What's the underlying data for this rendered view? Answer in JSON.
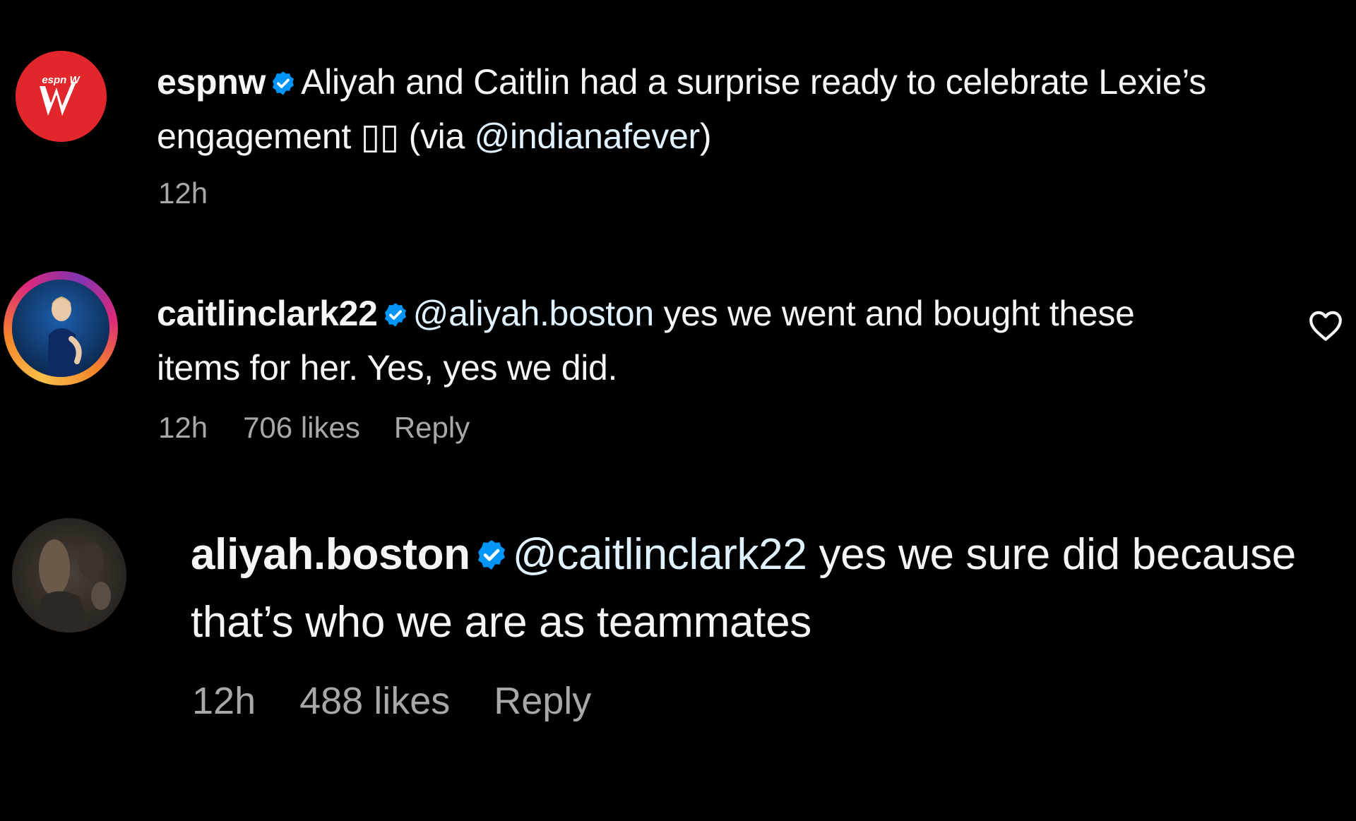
{
  "colors": {
    "background": "#000000",
    "text": "#f5f5f5",
    "secondary_text": "#a8a8a8",
    "mention": "#e0f1ff",
    "verified_badge": "#0095f6",
    "espnw_red": "#e1272b"
  },
  "comments": [
    {
      "username": "espnw",
      "verified": true,
      "avatar_icon": "espnw-logo-avatar",
      "avatar_logo_text": "espn W",
      "text_before": "Aliyah and Caitlin had a surprise ready to celebrate Lexie’s engagement ▯▯ (via ",
      "mention": "@indianafever",
      "text_after": ")",
      "time": "12h"
    },
    {
      "username": "caitlinclark22",
      "verified": true,
      "avatar_icon": "profile-photo-avatar",
      "has_story_ring": true,
      "mention": "@aliyah.boston",
      "text_after": " yes we went and bought these items for her. Yes, yes we did.",
      "time": "12h",
      "likes": "706 likes",
      "reply_label": "Reply",
      "like_icon": "heart-outline-icon"
    },
    {
      "username": "aliyah.boston",
      "verified": true,
      "avatar_icon": "profile-photo-avatar",
      "mention": "@caitlinclark22",
      "text_after": " yes we sure did because that’s who we are as teammates",
      "time": "12h",
      "likes": "488 likes",
      "reply_label": "Reply"
    }
  ]
}
